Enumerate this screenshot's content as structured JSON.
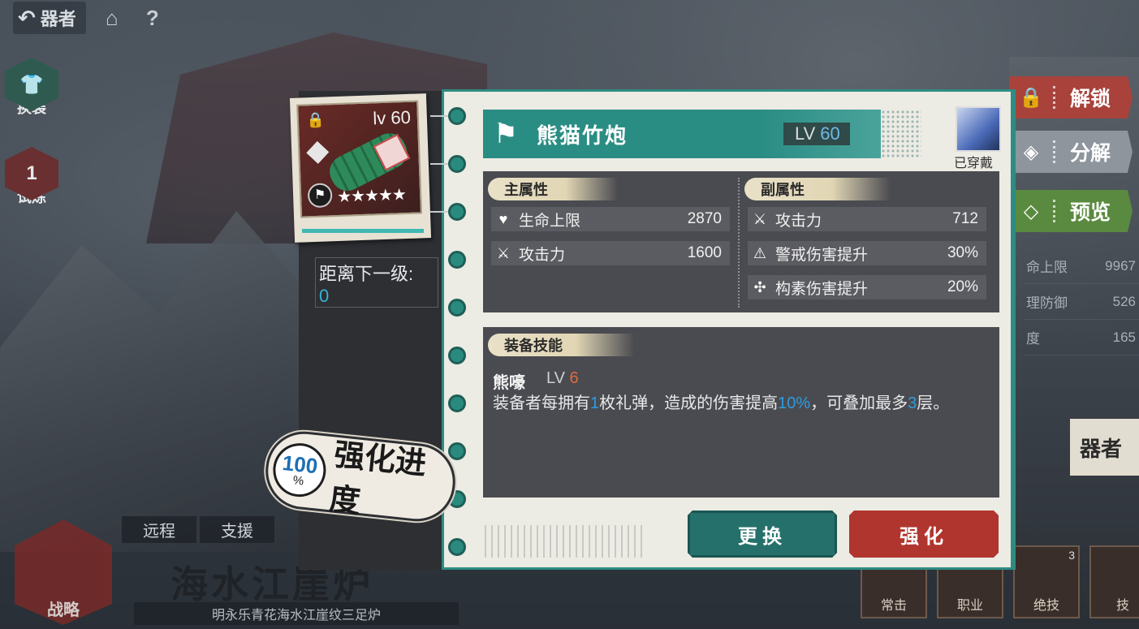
{
  "nav": {
    "back_label": "器者",
    "home_icon": "home-icon",
    "help_label": "?"
  },
  "left_badges": {
    "outfit_label": "换装",
    "heart_count": "1",
    "heart_label": "试炼"
  },
  "bottom_left": {
    "tags": [
      "远程",
      "支援"
    ],
    "strategy_label": "战略",
    "big_title": "海水江崖炉",
    "subtitle": "明永乐青花海水江崖纹三足炉"
  },
  "item_card": {
    "level": "lv 60",
    "stars": "★★★★★",
    "next_level_label": "距离下一级:",
    "next_level_value": "0"
  },
  "progress": {
    "percent": "100",
    "percent_sign": "%",
    "label": "强化进度"
  },
  "panel": {
    "title": "熊猫竹炮",
    "lv_prefix": "LV",
    "lv_value": "60",
    "equipped_label": "已穿戴",
    "main_attr_header": "主属性",
    "sub_attr_header": "副属性",
    "main_attrs": [
      {
        "icon": "heart-icon",
        "name": "生命上限",
        "value": "2870"
      },
      {
        "icon": "swords-icon",
        "name": "攻击力",
        "value": "1600"
      }
    ],
    "sub_attrs": [
      {
        "icon": "swords-icon",
        "name": "攻击力",
        "value": "712"
      },
      {
        "icon": "alert-icon",
        "name": "警戒伤害提升",
        "value": "30%"
      },
      {
        "icon": "element-icon",
        "name": "构素伤害提升",
        "value": "20%"
      }
    ],
    "skill_header": "装备技能",
    "skill_name": "熊嚎",
    "skill_lv_prefix": "LV",
    "skill_lv_value": "6",
    "skill_desc_parts": [
      "装备者每拥有",
      "1",
      "枚礼弹，造成的伤害提高",
      "10%",
      "，可叠加最多",
      "3",
      "层。"
    ],
    "change_label": "更换",
    "enhance_label": "强化"
  },
  "side_buttons": {
    "unlock": "解锁",
    "decompose": "分解",
    "preview": "预览"
  },
  "ghost_stats": [
    {
      "name": "命上限",
      "value": "9967"
    },
    {
      "name": "理防御",
      "value": "526"
    },
    {
      "name": "度",
      "value": "165"
    }
  ],
  "ghost_name": "器者",
  "bottom_icons": [
    "常击",
    "职业",
    "绝技",
    "技"
  ],
  "bottom_icon_badge": "3",
  "colors": {
    "teal": "#2a8d84",
    "red": "#b0352e",
    "highlight_blue": "#2d9be0",
    "lv_orange": "#e06b3d"
  }
}
